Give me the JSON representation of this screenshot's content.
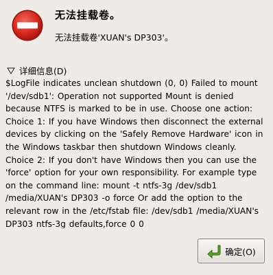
{
  "dialog": {
    "title": "无法挂载卷。",
    "subtitle": "无法挂载卷'XUAN's DP303'。",
    "details_toggle_label": "详细信息(D)",
    "details_text": "$LogFile indicates unclean shutdown (0, 0) Failed to mount '/dev/sdb1': Operation not supported Mount is denied because NTFS is marked to be in use. Choose one action: Choice 1: If you have Windows then disconnect the external devices by clicking on the 'Safely Remove Hardware' icon in the Windows taskbar then shutdown Windows cleanly. Choice 2: If you don't have Windows then you can use the 'force' option for your own responsibility. For example type on the command line: mount -t ntfs-3g /dev/sdb1 /media/XUAN's DP303 -o force Or add the option to the relevant row in the /etc/fstab file: /dev/sdb1 /media/XUAN's DP303 ntfs-3g defaults,force 0 0",
    "ok_label": "确定(O)",
    "icons": {
      "error": "stop-error-icon",
      "expander": "triangle-down-icon",
      "ok": "green-enter-arrow-icon"
    },
    "colors": {
      "background": "#efebe7",
      "error_red": "#d8281e",
      "ok_arrow_green": "#5fa62a"
    }
  }
}
